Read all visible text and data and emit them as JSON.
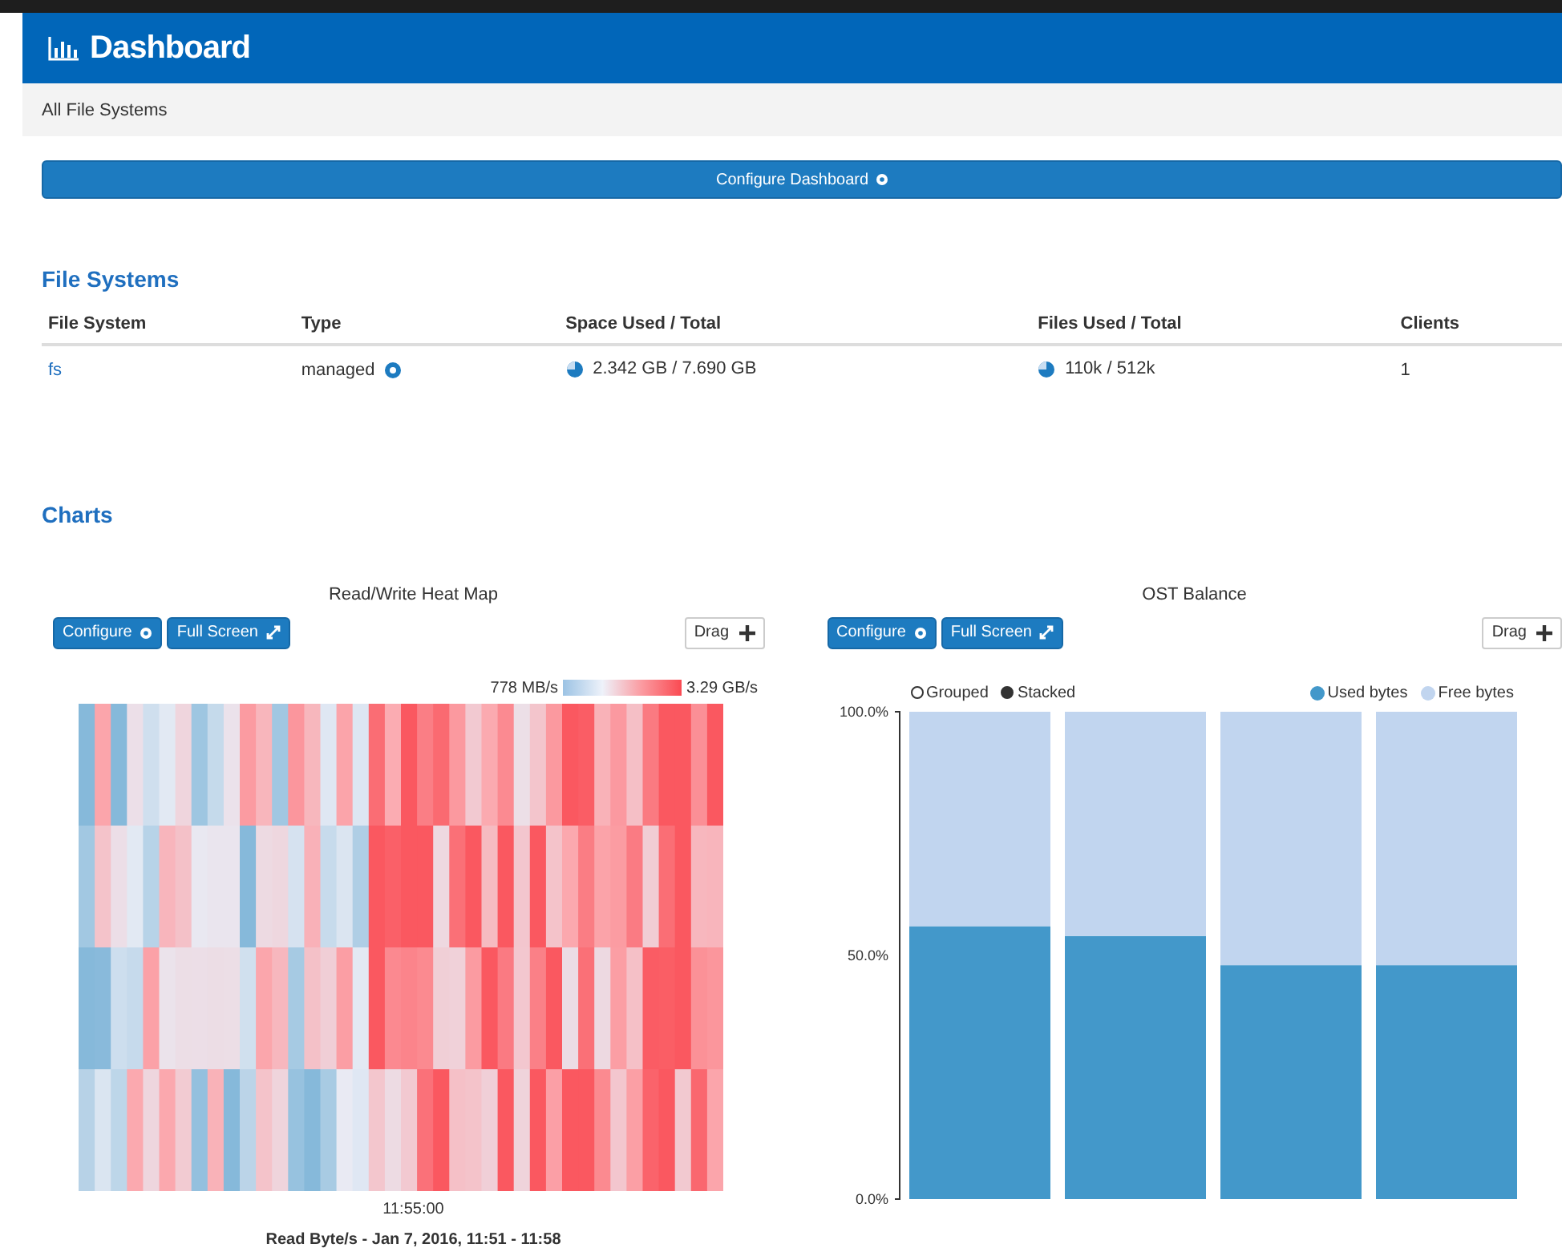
{
  "header": {
    "title": "Dashboard"
  },
  "breadcrumb": "All File Systems",
  "configure_dashboard": "Configure Dashboard",
  "file_systems": {
    "title": "File Systems",
    "columns": [
      "File System",
      "Type",
      "Space Used / Total",
      "Files Used / Total",
      "Clients"
    ],
    "rows": [
      {
        "file_system": "fs",
        "type": "managed",
        "space": "2.342 GB / 7.690 GB",
        "files": "110k / 512k",
        "clients": "1"
      }
    ]
  },
  "charts_title": "Charts",
  "charts": [
    {
      "kind": "heatmap",
      "title": "Read/Write Heat Map",
      "buttons": [
        "Configure",
        "Full Screen"
      ],
      "drag": "Drag",
      "scale_min": "778 MB/s",
      "scale_max": "3.29 GB/s",
      "x_tick": "11:55:00",
      "caption": "Read Byte/s - Jan 7, 2016, 11:51 - 11:58"
    },
    {
      "kind": "bar",
      "title": "OST Balance",
      "buttons": [
        "Configure",
        "Full Screen"
      ],
      "drag": "Drag",
      "modes": [
        {
          "label": "Grouped",
          "selected": false
        },
        {
          "label": "Stacked",
          "selected": true
        }
      ],
      "chart_data": {
        "type": "bar",
        "stacked": true,
        "ylim": [
          0,
          100
        ],
        "yticks": [
          {
            "value": 0,
            "label": "0.0%"
          },
          {
            "value": 50,
            "label": "50.0%"
          },
          {
            "value": 100,
            "label": "100.0%"
          }
        ],
        "series": [
          {
            "name": "Used bytes",
            "color": "#4398ca",
            "values": [
              56,
              54,
              48,
              48
            ]
          },
          {
            "name": "Free bytes",
            "color": "#c1d5ef",
            "values": [
              44,
              46,
              52,
              52
            ]
          }
        ]
      }
    }
  ]
}
